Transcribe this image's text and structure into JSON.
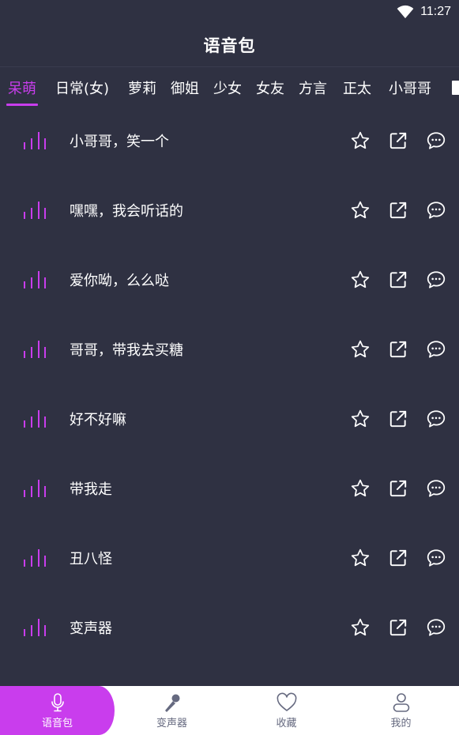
{
  "status": {
    "time": "11:27",
    "wifi_icon": "wifi-icon"
  },
  "header": {
    "title": "语音包"
  },
  "tabs": [
    {
      "label": "呆萌",
      "active": true
    },
    {
      "label": "日常(女)",
      "active": false
    },
    {
      "label": "萝莉",
      "active": false
    },
    {
      "label": "御姐",
      "active": false
    },
    {
      "label": "少女",
      "active": false
    },
    {
      "label": "女友",
      "active": false
    },
    {
      "label": "方言",
      "active": false
    },
    {
      "label": "正太",
      "active": false
    },
    {
      "label": "小哥哥",
      "active": false
    },
    {
      "label": "",
      "active": false
    }
  ],
  "items": [
    {
      "label": "小哥哥，笑一个"
    },
    {
      "label": "嘿嘿，我会听话的"
    },
    {
      "label": "爱你呦，么么哒"
    },
    {
      "label": "哥哥，带我去买糖"
    },
    {
      "label": "好不好嘛"
    },
    {
      "label": "带我走"
    },
    {
      "label": "丑八怪"
    },
    {
      "label": "变声器"
    }
  ],
  "nav": [
    {
      "label": "语音包",
      "icon": "microphone-icon",
      "active": true
    },
    {
      "label": "变声器",
      "icon": "karaoke-mic-icon",
      "active": false
    },
    {
      "label": "收藏",
      "icon": "heart-icon",
      "active": false
    },
    {
      "label": "我的",
      "icon": "user-icon",
      "active": false
    }
  ],
  "colors": {
    "background": "#2f3142",
    "accent": "#c93ded",
    "text": "#ffffff",
    "nav_inactive": "#666a80"
  }
}
